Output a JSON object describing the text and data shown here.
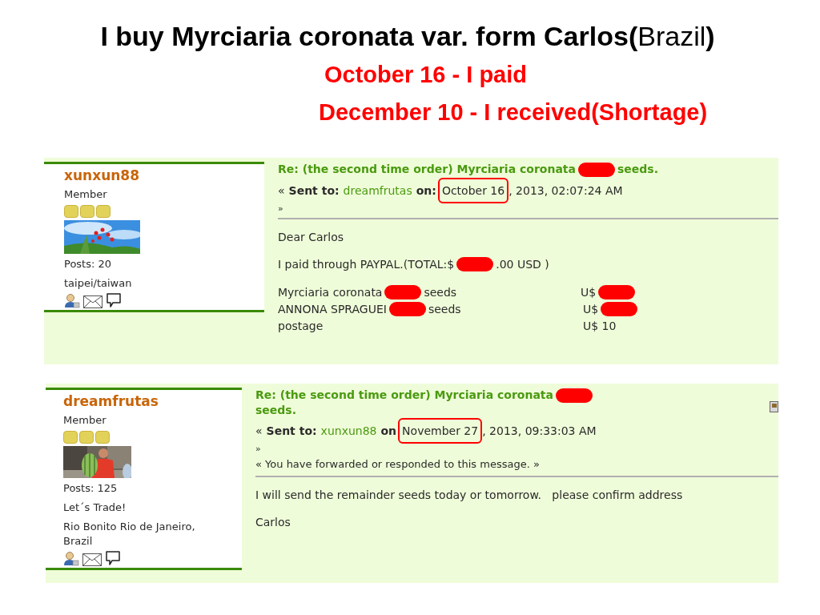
{
  "slide_title": "**I buy Myrciaria coronata var. form Carlos(**Brazil**)**",
  "timeline": [
    "October 16 - I paid",
    "December 10 - I received(Shortage)"
  ],
  "messages": [
    {
      "author": {
        "name": "xunxun88",
        "rank": "Member",
        "stars": 3,
        "avatar": {
          "kind": "picture"
        },
        "posts": "Posts: 20",
        "extra": [
          "taipei/taiwan"
        ]
      },
      "subject": [
        {
          "text": "Re: (the second time order) Myrciaria coronata"
        },
        {
          "kind": "redacted"
        },
        {
          "text": "seeds."
        }
      ],
      "sent": {
        "open": "«",
        "label": "Sent to:",
        "recipient": "dreamfrutas",
        "on": "on:",
        "date": "October 16",
        "date_rest": ", 2013, 02:07:24 AM",
        "date_circled": true,
        "close": "»"
      },
      "corner_icon": false,
      "body": [
        {
          "kind": "paragraph",
          "segments": [
            {
              "text": "Dear Carlos"
            }
          ]
        },
        {
          "kind": "paragraph",
          "segments": [
            {
              "text": "I paid through PAYPAL.(TOTAL:$"
            },
            {
              "kind": "redacted"
            },
            {
              "text": ".00 USD )"
            }
          ]
        },
        {
          "kind": "items",
          "rows": [
            {
              "name": [
                {
                  "text": "Myrciaria coronata"
                },
                {
                  "kind": "redacted"
                },
                {
                  "text": "seeds"
                }
              ],
              "price": [
                {
                  "text": "U$"
                },
                {
                  "kind": "redacted"
                }
              ]
            },
            {
              "name": [
                {
                  "text": "ANNONA SPRAGUEI"
                },
                {
                  "kind": "redacted"
                },
                {
                  "text": "seeds"
                }
              ],
              "price": [
                {
                  "text": "U$"
                },
                {
                  "kind": "redacted"
                }
              ]
            },
            {
              "name": [
                {
                  "text": "postage"
                }
              ],
              "price": [
                {
                  "text": "U$ 10"
                }
              ]
            }
          ]
        }
      ]
    },
    {
      "author": {
        "name": "dreamfrutas",
        "rank": "Member",
        "stars": 3,
        "avatar": {
          "kind": "picture"
        },
        "posts": "Posts: 125",
        "extra": [
          "Let´s Trade!",
          "Rio Bonito Rio de Janeiro, Brazil"
        ]
      },
      "subject": [
        {
          "text": "Re: (the second time order) Myrciaria coronata"
        },
        {
          "kind": "redacted"
        },
        {
          "text": "seeds."
        }
      ],
      "sent": {
        "open": "«",
        "label": "Sent to:",
        "recipient": "xunxun88",
        "on": "on",
        "date": "November 27",
        "date_rest": ", 2013, 09:33:03 AM",
        "date_circled": true,
        "close": "»"
      },
      "notice": "« You have forwarded or responded to this message. »",
      "corner_icon": true,
      "body": [
        {
          "kind": "paragraph",
          "segments": [
            {
              "text": "I will send the remainder seeds today or tomorrow.   please confirm address"
            }
          ]
        },
        {
          "kind": "paragraph",
          "segments": [
            {
              "text": "Carlos"
            }
          ]
        }
      ]
    }
  ]
}
